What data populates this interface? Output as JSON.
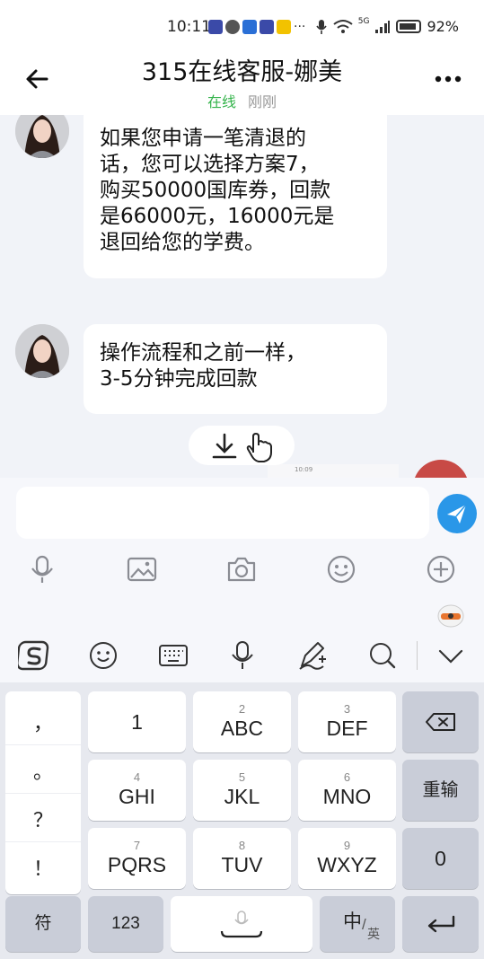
{
  "status_bar": {
    "time": "10:11",
    "more_notifications": "···",
    "signal_label": "5G",
    "battery_percent": "92%"
  },
  "header": {
    "title": "315在线客服-娜美",
    "online_status": "在线",
    "last_seen": "刚刚"
  },
  "messages": [
    {
      "sender": "agent",
      "lines": [
        "如果您申请一笔清退的",
        "话，您可以选择方案7，",
        "购买50000国库券，回款",
        "是66000元，16000元是",
        "退回给您的学费。"
      ]
    },
    {
      "sender": "agent",
      "lines": [
        "操作流程和之前一样，",
        "3-5分钟完成回款"
      ]
    }
  ],
  "partial_thumbnail_text": "10:09",
  "input": {
    "value": "",
    "placeholder": ""
  },
  "tools": [
    "mic-icon",
    "image-icon",
    "camera-icon",
    "emoji-icon",
    "plus-icon"
  ],
  "keyboard": {
    "punctuation": [
      "，",
      "。",
      "？",
      "！"
    ],
    "rows": [
      [
        {
          "sub": "",
          "main": "1"
        },
        {
          "sub": "2",
          "main": "ABC"
        },
        {
          "sub": "3",
          "main": "DEF"
        }
      ],
      [
        {
          "sub": "4",
          "main": "GHI"
        },
        {
          "sub": "5",
          "main": "JKL"
        },
        {
          "sub": "6",
          "main": "MNO"
        }
      ],
      [
        {
          "sub": "7",
          "main": "PQRS"
        },
        {
          "sub": "8",
          "main": "TUV"
        },
        {
          "sub": "9",
          "main": "WXYZ"
        }
      ]
    ],
    "retype_label": "重输",
    "zero_label": "0",
    "symbols_label": "符",
    "numbers_label": "123",
    "lang_main": "中",
    "lang_sub": "英"
  },
  "colors": {
    "online_green": "#33b34a",
    "send_blue": "#2a97e8",
    "chat_background": "#f1f3f8"
  }
}
